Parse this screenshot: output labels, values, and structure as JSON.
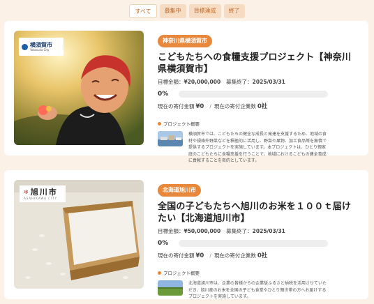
{
  "tabs": [
    {
      "label": "すべて"
    },
    {
      "label": "募集中"
    },
    {
      "label": "目標達成"
    },
    {
      "label": "終了"
    }
  ],
  "projects": [
    {
      "photo_logo_city": "横須賀市",
      "photo_logo_sub": "Yokosuka City",
      "prefecture": "神奈川県横須賀市",
      "title": "こどもたちへの食糧支援プロジェクト【神奈川県横須賀市】",
      "target_label": "目標金額：",
      "target_amount": "¥20,000,000",
      "end_label": "募集終了：",
      "end_date": "2025/03/31",
      "progress_pct": "0%",
      "progress_value": 0,
      "current_label": "現在の寄付金額",
      "current_amount": "¥0",
      "companies_label": "現在の寄付企業数",
      "companies_count": "0社",
      "summary_label": "プロジェクト概要",
      "summary": "横須賀市では、こどもたちの健全な成長と発達を支援するため、地域の食材や規格外野菜などを積極的に活用し、野菜や果物、加工食品等を無償で提供するプロジェクトを実施しています。本プロジェクトは、ひとり親家庭のこどもたちに食糧支援を行うことで、地域におけるこどもの健全育成に貢献することを目的としています。"
    },
    {
      "photo_logo_city": "旭川市",
      "photo_logo_sub": "ASAHIKAWA CITY",
      "prefecture": "北海道旭川市",
      "title": "全国の子どもたちへ旭川のお米を１００ｔ届けたい【北海道旭川市】",
      "target_label": "目標金額：",
      "target_amount": "¥50,000,000",
      "end_label": "募集終了：",
      "end_date": "2025/03/31",
      "progress_pct": "0%",
      "progress_value": 0,
      "current_label": "現在の寄付金額",
      "current_amount": "¥0",
      "companies_label": "現在の寄付企業数",
      "companies_count": "0社",
      "summary_label": "プロジェクト概要",
      "summary": "北海道旭川市は、企業の皆様からの企業版ふるさと納税を活用させていただき、旭川産のお米を全国の子ども食堂やひとり親世帯の方へお届けするプロジェクトを実施しています。"
    }
  ],
  "colors": {
    "accent": "#e8883c",
    "background": "#fbf1e6"
  }
}
